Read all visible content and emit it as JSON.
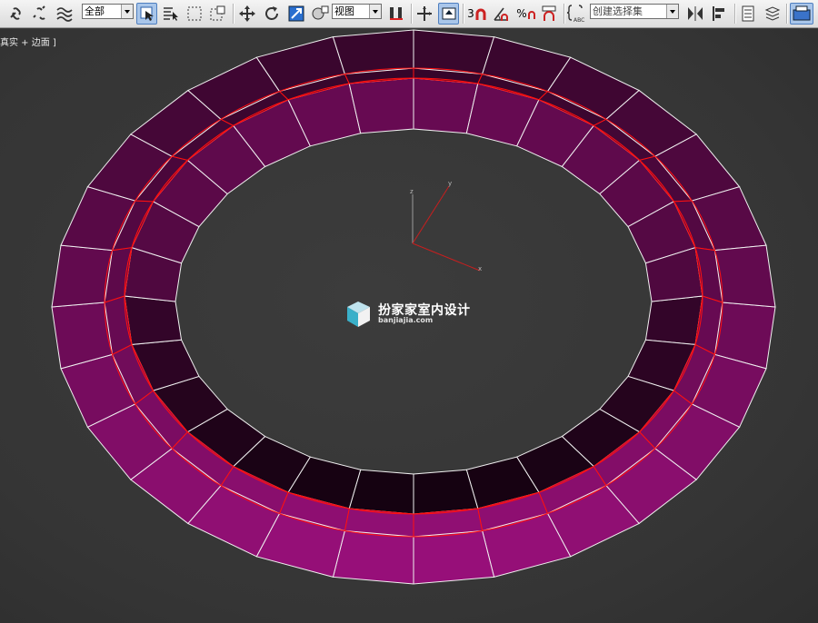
{
  "toolbar": {
    "selection_filter": "全部",
    "reference_coord": "视图",
    "named_selection_placeholder": "创建选择集",
    "snap_label": "3",
    "percent_snap": "%",
    "abc_label": "ABC"
  },
  "viewport": {
    "label": "真实 + 边面 ]",
    "axis_labels": {
      "x": "x",
      "y": "y",
      "z": "z"
    }
  },
  "watermark": {
    "title": "扮家家室内设计",
    "subtitle": "banjiajia.com"
  },
  "colors": {
    "mesh_face": "#8a0e6e",
    "edge_white": "#f0f0f0",
    "edge_selected": "#ff1010",
    "active_tool": "#a9c6ea"
  },
  "icons": [
    "link-icon",
    "unlink-icon",
    "bind-space-warp-icon",
    "select-object-icon",
    "select-by-name-icon",
    "rectangle-region-icon",
    "window-crossing-icon",
    "move-icon",
    "rotate-icon",
    "scale-icon",
    "select-manipulate-icon",
    "pivot-icon",
    "keyboard-shortcut-icon",
    "snap-toggle-icon",
    "angle-snap-icon",
    "percent-snap-icon",
    "spinner-snap-icon",
    "edit-named-selection-icon",
    "mirror-icon",
    "align-icon",
    "layer-explorer-icon",
    "scene-explorer-icon",
    "render-setup-icon"
  ]
}
